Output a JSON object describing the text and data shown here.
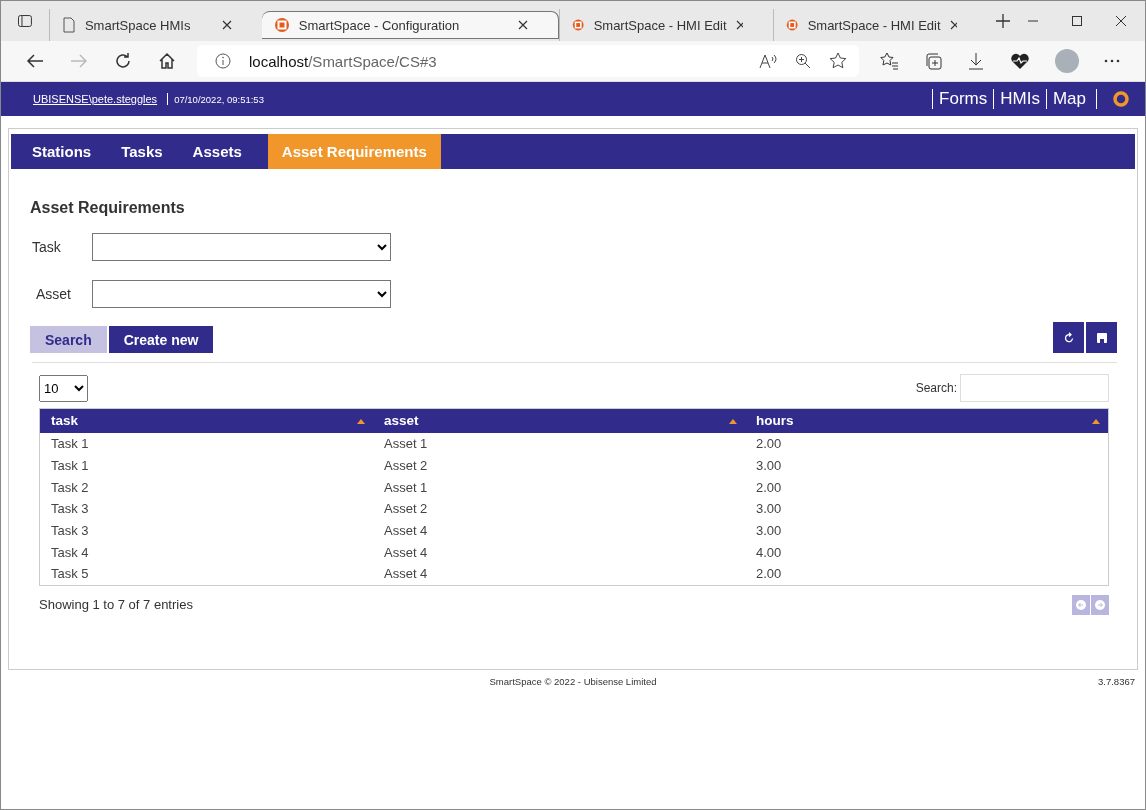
{
  "browser": {
    "tabs": [
      {
        "title": "SmartSpace HMIs",
        "kind": "page",
        "selected": false
      },
      {
        "title": "SmartSpace - Configuration",
        "kind": "app",
        "selected": true
      },
      {
        "title": "SmartSpace - HMI Edit",
        "kind": "app",
        "selected": false
      },
      {
        "title": "SmartSpace - HMI Edit",
        "kind": "app",
        "selected": false
      }
    ],
    "address": {
      "host": "localhost",
      "path": "/SmartSpace/CS#3"
    }
  },
  "header": {
    "user": "UBISENSE\\pete.steggles",
    "datetime": "07/10/2022, 09:51:53",
    "links": [
      "Forms",
      "HMIs",
      "Map"
    ]
  },
  "tabs": [
    {
      "label": "Stations",
      "selected": false
    },
    {
      "label": "Tasks",
      "selected": false
    },
    {
      "label": "Assets",
      "selected": false
    },
    {
      "label": "Asset Requirements",
      "selected": true
    }
  ],
  "heading": "Asset Requirements",
  "filters": [
    {
      "label": "Task"
    },
    {
      "label": "Asset"
    }
  ],
  "buttons": [
    {
      "label": "Search",
      "kind": "light"
    },
    {
      "label": "Create new",
      "kind": "dark"
    }
  ],
  "table": {
    "page_size": "10",
    "search_label": "Search:",
    "columns": [
      "task",
      "asset",
      "hours"
    ],
    "rows": [
      [
        "Task 1",
        "Asset 1",
        "2.00"
      ],
      [
        "Task 1",
        "Asset 2",
        "3.00"
      ],
      [
        "Task 2",
        "Asset 1",
        "2.00"
      ],
      [
        "Task 3",
        "Asset 2",
        "3.00"
      ],
      [
        "Task 3",
        "Asset 4",
        "3.00"
      ],
      [
        "Task 4",
        "Asset 4",
        "4.00"
      ],
      [
        "Task 5",
        "Asset 4",
        "2.00"
      ]
    ],
    "info": "Showing 1 to 7 of 7 entries"
  },
  "footer": {
    "copyright": "SmartSpace © 2022 - Ubisense Limited",
    "version": "3.7.8367"
  }
}
